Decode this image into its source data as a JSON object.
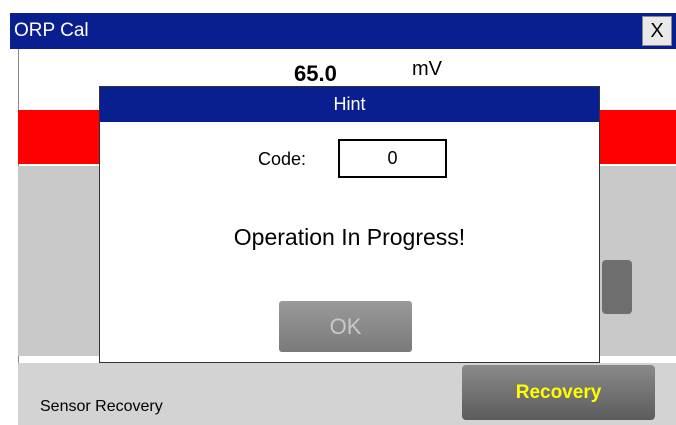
{
  "window": {
    "title": "ORP Cal",
    "close_label": "X"
  },
  "reading": {
    "value": "65.0",
    "unit": "mV"
  },
  "recovery": {
    "label": "Sensor Recovery",
    "button_label": "Recovery"
  },
  "dialog": {
    "title": "Hint",
    "code_label": "Code:",
    "code_value": "0",
    "message": "Operation In Progress!",
    "ok_label": "OK"
  },
  "colors": {
    "titlebar": "#0a1f8f",
    "alarm_bar": "#ff0000",
    "recovery_text": "#ffff00"
  }
}
